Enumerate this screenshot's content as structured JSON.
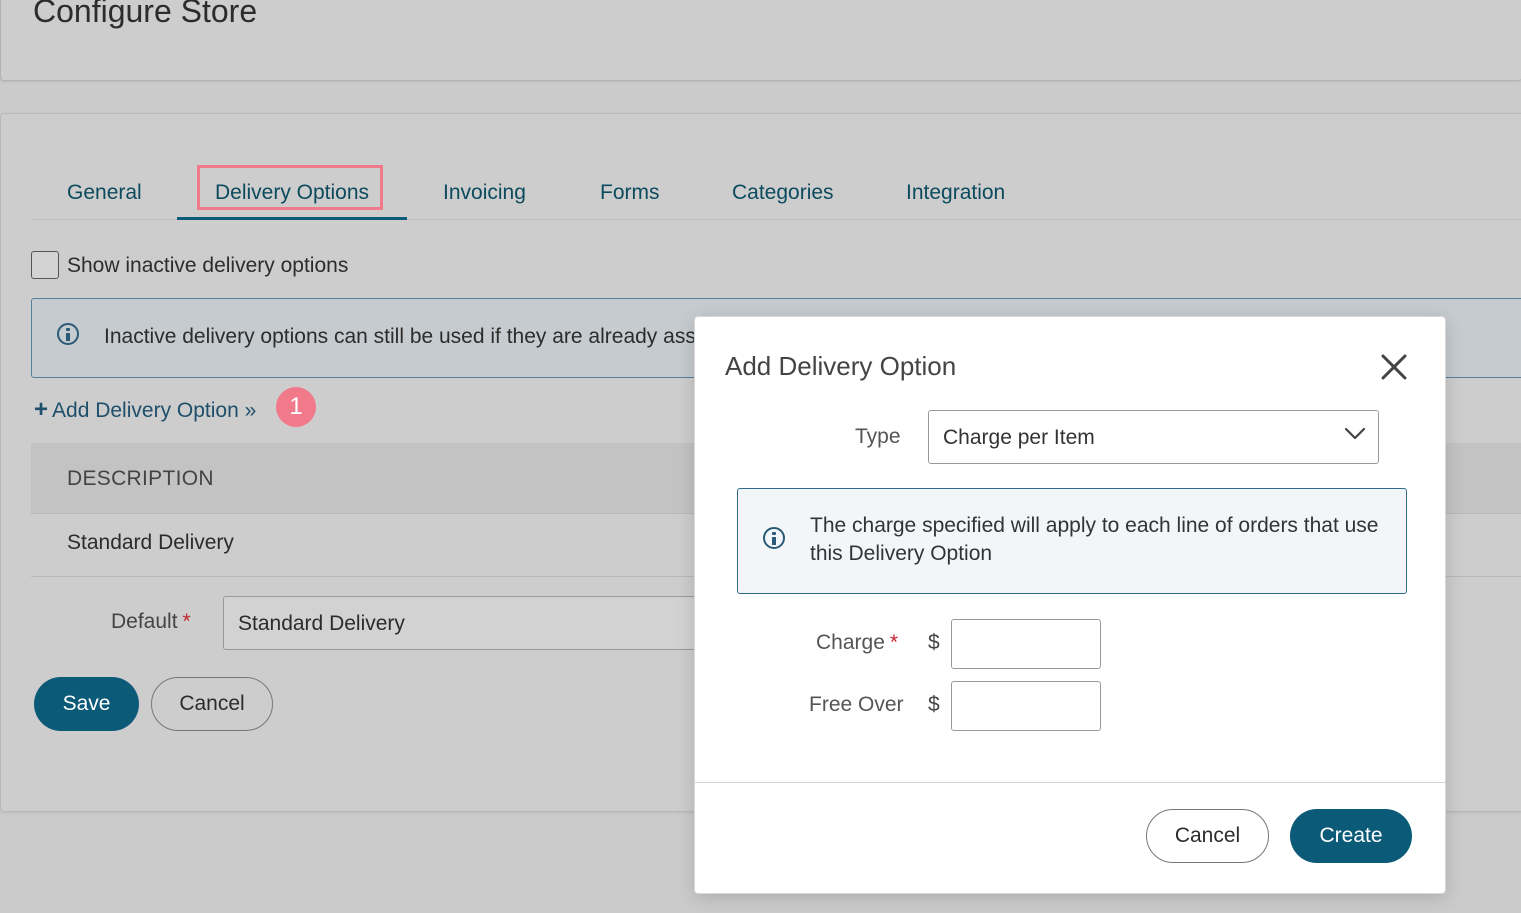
{
  "page": {
    "title": "Configure Store"
  },
  "tabs": [
    {
      "label": "General"
    },
    {
      "label": "Delivery Options"
    },
    {
      "label": "Invoicing"
    },
    {
      "label": "Forms"
    },
    {
      "label": "Categories"
    },
    {
      "label": "Integration"
    }
  ],
  "active_tab": "Delivery Options",
  "show_inactive": {
    "label": "Show inactive delivery options",
    "checked": false
  },
  "info_banner": {
    "text": "Inactive delivery options can still be used if they are already ass"
  },
  "add_link": {
    "plus": "+",
    "label": "Add Delivery Option »"
  },
  "step_badge": "1",
  "table": {
    "header": "DESCRIPTION",
    "rows": [
      {
        "description": "Standard Delivery"
      }
    ]
  },
  "default_field": {
    "label": "Default",
    "required_mark": "*",
    "value": "Standard Delivery"
  },
  "form_buttons": {
    "save": "Save",
    "cancel": "Cancel"
  },
  "modal": {
    "title": "Add Delivery Option",
    "type_label": "Type",
    "type_value": "Charge per Item",
    "info_text": "The charge specified will apply to each line of orders that use this Delivery Option",
    "charge_label": "Charge",
    "charge_required_mark": "*",
    "currency_symbol": "$",
    "charge_value": "",
    "free_over_label": "Free Over",
    "free_over_value": "",
    "cancel_label": "Cancel",
    "create_label": "Create"
  },
  "colors": {
    "primary": "#0b5a78",
    "highlight": "#f07a8a",
    "tab_text": "#0c4a5e",
    "required": "#c0262d"
  },
  "icons": {
    "info": "info-icon",
    "close": "close-icon",
    "chevron": "chevron-down-icon",
    "plus": "plus-icon"
  }
}
